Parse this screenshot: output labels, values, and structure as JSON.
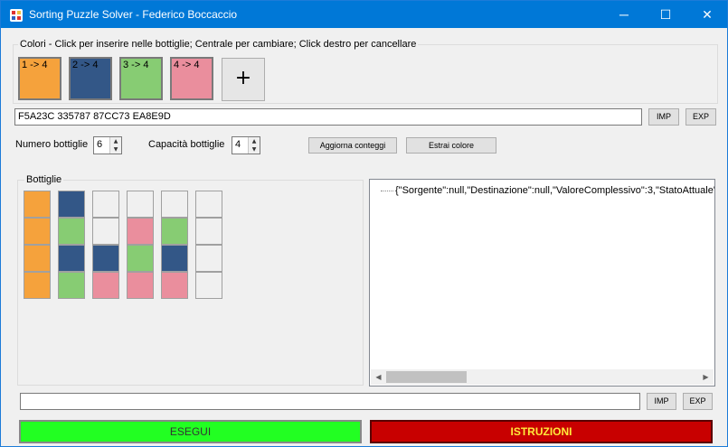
{
  "window": {
    "title": "Sorting Puzzle Solver - Federico Boccaccio",
    "icon": "app-icon",
    "controls": {
      "minimize": "─",
      "maximize": "☐",
      "close": "✕"
    }
  },
  "colors_group": {
    "label": "Colori - Click per inserire nelle bottiglie; Centrale per cambiare; Click destro per cancellare",
    "swatches": [
      {
        "label": "1 -> 4",
        "color": "#F5A23C"
      },
      {
        "label": "2 -> 4",
        "color": "#335787"
      },
      {
        "label": "3 -> 4",
        "color": "#87CC73"
      },
      {
        "label": "4 -> 4",
        "color": "#EA8E9D"
      }
    ],
    "add_label": "+"
  },
  "color_codes": {
    "value": "F5A23C 335787 87CC73 EA8E9D",
    "imp_label": "IMP",
    "exp_label": "EXP"
  },
  "settings": {
    "num_bottles_label": "Numero bottiglie",
    "num_bottles_value": "6",
    "capacity_label": "Capacità bottiglie",
    "capacity_value": "4",
    "update_counts_label": "Aggiorna conteggi",
    "extract_color_label": "Estrai colore"
  },
  "bottles_group": {
    "label": "Bottiglie",
    "bottles": [
      [
        "#F5A23C",
        "#F5A23C",
        "#F5A23C",
        "#F5A23C"
      ],
      [
        "#335787",
        "#87CC73",
        "#335787",
        "#87CC73"
      ],
      [
        "#F0F0F0",
        "#F0F0F0",
        "#335787",
        "#EA8E9D"
      ],
      [
        "#F0F0F0",
        "#EA8E9D",
        "#87CC73",
        "#EA8E9D"
      ],
      [
        "#F0F0F0",
        "#87CC73",
        "#335787",
        "#EA8E9D"
      ],
      [
        "#F0F0F0",
        "#F0F0F0",
        "#F0F0F0",
        "#F0F0F0"
      ]
    ]
  },
  "solution_tree": {
    "node": "{\"Sorgente\":null,\"Destinazione\":null,\"ValoreComplessivo\":3,\"StatoAttuale\":"
  },
  "bottom_input": {
    "value": "",
    "imp_label": "IMP",
    "exp_label": "EXP"
  },
  "actions": {
    "run_label": "ESEGUI",
    "run_color": "#22FF22",
    "instructions_label": "ISTRUZIONI",
    "instructions_color": "#C80000"
  }
}
